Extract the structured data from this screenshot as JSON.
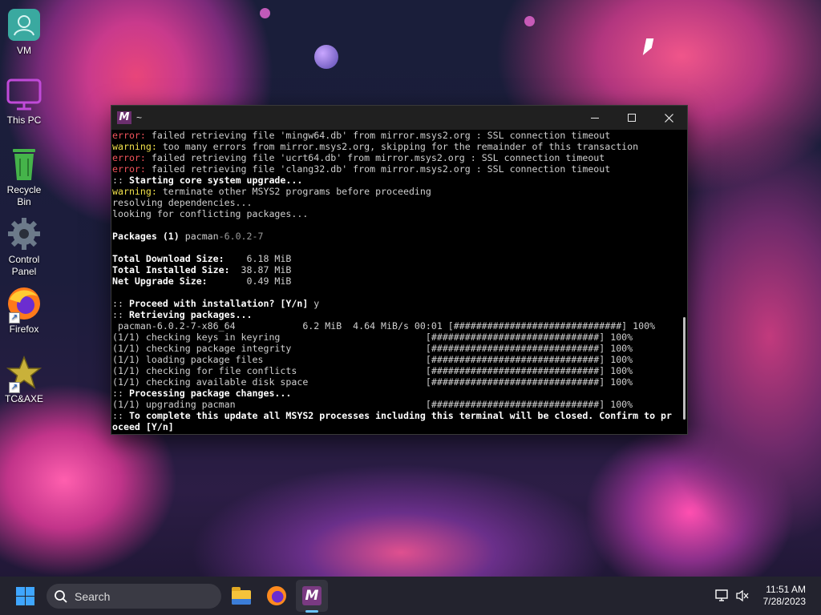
{
  "desktop": {
    "icons": [
      {
        "label": "VM",
        "icon": "vm-icon"
      },
      {
        "label": "This PC",
        "icon": "monitor-icon"
      },
      {
        "label": "Recycle\nBin",
        "icon": "recycle-bin-icon"
      },
      {
        "label": "Control\nPanel",
        "icon": "gear-icon"
      },
      {
        "label": "Firefox",
        "icon": "firefox-icon"
      },
      {
        "label": "TC&AXE",
        "icon": "star-icon"
      }
    ]
  },
  "terminal": {
    "app_icon_text": "M",
    "title": "~",
    "buttons": {
      "minimize": "—",
      "maximize": "☐",
      "close": "✕"
    },
    "lines": [
      {
        "segments": [
          {
            "t": "error:",
            "c": "err"
          },
          {
            "t": " failed retrieving file 'mingw64.db' from mirror.msys2.org : SSL connection timeout",
            "c": "norm"
          }
        ]
      },
      {
        "segments": [
          {
            "t": "warning:",
            "c": "warn"
          },
          {
            "t": " too many errors from mirror.msys2.org, skipping for the remainder of this transaction",
            "c": "norm"
          }
        ]
      },
      {
        "segments": [
          {
            "t": "error:",
            "c": "err"
          },
          {
            "t": " failed retrieving file 'ucrt64.db' from mirror.msys2.org : SSL connection timeout",
            "c": "norm"
          }
        ]
      },
      {
        "segments": [
          {
            "t": "error:",
            "c": "err"
          },
          {
            "t": " failed retrieving file 'clang32.db' from mirror.msys2.org : SSL connection timeout",
            "c": "norm"
          }
        ]
      },
      {
        "segments": [
          {
            "t": "::",
            "c": "norm"
          },
          {
            "t": " Starting core system upgrade...",
            "c": "bold"
          }
        ]
      },
      {
        "segments": [
          {
            "t": "warning:",
            "c": "warn"
          },
          {
            "t": " terminate other MSYS2 programs before proceeding",
            "c": "norm"
          }
        ]
      },
      {
        "segments": [
          {
            "t": "resolving dependencies...",
            "c": "norm"
          }
        ]
      },
      {
        "segments": [
          {
            "t": "looking for conflicting packages...",
            "c": "norm"
          }
        ]
      },
      {
        "segments": [
          {
            "t": "",
            "c": "norm"
          }
        ]
      },
      {
        "segments": [
          {
            "t": "Packages (1) ",
            "c": "bold"
          },
          {
            "t": "pacman",
            "c": "norm"
          },
          {
            "t": "-6.0.2-7",
            "c": "dim"
          }
        ]
      },
      {
        "segments": [
          {
            "t": "",
            "c": "norm"
          }
        ]
      },
      {
        "segments": [
          {
            "t": "Total Download Size:",
            "c": "bold"
          },
          {
            "t": "    6.18 MiB",
            "c": "norm"
          }
        ]
      },
      {
        "segments": [
          {
            "t": "Total Installed Size:",
            "c": "bold"
          },
          {
            "t": "  38.87 MiB",
            "c": "norm"
          }
        ]
      },
      {
        "segments": [
          {
            "t": "Net Upgrade Size:",
            "c": "bold"
          },
          {
            "t": "       0.49 MiB",
            "c": "norm"
          }
        ]
      },
      {
        "segments": [
          {
            "t": "",
            "c": "norm"
          }
        ]
      },
      {
        "segments": [
          {
            "t": "::",
            "c": "norm"
          },
          {
            "t": " Proceed with installation? [Y/n]",
            "c": "bold"
          },
          {
            "t": " y",
            "c": "norm"
          }
        ]
      },
      {
        "segments": [
          {
            "t": "::",
            "c": "norm"
          },
          {
            "t": " Retrieving packages...",
            "c": "bold"
          }
        ]
      },
      {
        "segments": [
          {
            "t": " pacman-6.0.2-7-x86_64            6.2 MiB  4.64 MiB/s 00:01 [##############################] 100%",
            "c": "norm"
          }
        ]
      },
      {
        "segments": [
          {
            "t": "(1/1) checking keys in keyring                          [##############################] 100%",
            "c": "norm"
          }
        ]
      },
      {
        "segments": [
          {
            "t": "(1/1) checking package integrity                        [##############################] 100%",
            "c": "norm"
          }
        ]
      },
      {
        "segments": [
          {
            "t": "(1/1) loading package files                             [##############################] 100%",
            "c": "norm"
          }
        ]
      },
      {
        "segments": [
          {
            "t": "(1/1) checking for file conflicts                       [##############################] 100%",
            "c": "norm"
          }
        ]
      },
      {
        "segments": [
          {
            "t": "(1/1) checking available disk space                     [##############################] 100%",
            "c": "norm"
          }
        ]
      },
      {
        "segments": [
          {
            "t": "::",
            "c": "norm"
          },
          {
            "t": " Processing package changes...",
            "c": "bold"
          }
        ]
      },
      {
        "segments": [
          {
            "t": "(1/1) upgrading pacman                                  [##############################] 100%",
            "c": "norm"
          }
        ]
      },
      {
        "segments": [
          {
            "t": "::",
            "c": "norm"
          },
          {
            "t": " To complete this update all MSYS2 processes including this terminal will be closed. Confirm to pr",
            "c": "bold"
          }
        ]
      },
      {
        "segments": [
          {
            "t": "oceed [Y/n]",
            "c": "bold"
          }
        ]
      }
    ],
    "colors": {
      "error": "#f2545b",
      "warning": "#f0e04a",
      "bold": "#ffffff",
      "normal": "#cfcfcf",
      "dim": "#9a9a9a"
    }
  },
  "taskbar": {
    "search_placeholder": "Search",
    "apps": [
      {
        "name": "file-explorer",
        "icon": "folder-icon"
      },
      {
        "name": "firefox",
        "icon": "firefox-icon"
      },
      {
        "name": "msys2",
        "icon": "msys2-icon",
        "active": true
      }
    ],
    "tray": {
      "network_icon": "network-icon",
      "volume_icon": "volume-muted-icon"
    },
    "clock": {
      "time": "11:51 AM",
      "date": "7/28/2023"
    },
    "accent": "#3fa6ff"
  }
}
